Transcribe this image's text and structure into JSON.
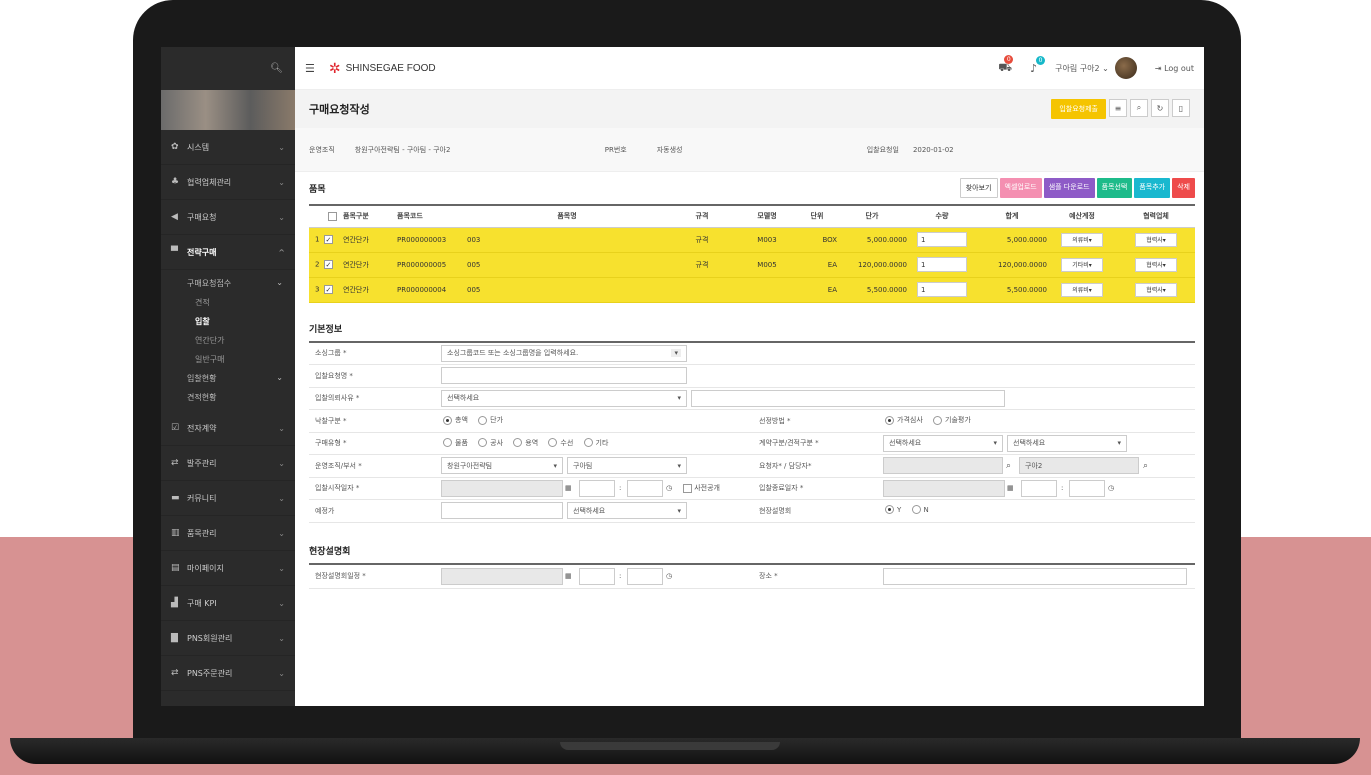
{
  "app": {
    "brand": "SHINSEGAE FOOD",
    "user": "구아림 구아2 ⌄",
    "logout": "Log out",
    "cart_badge": "0",
    "bell_badge": "0"
  },
  "sidebar": {
    "items": [
      {
        "label": "시스템",
        "icon": "gear-icon"
      },
      {
        "label": "협력업체관리",
        "icon": "users-icon"
      },
      {
        "label": "구매요청",
        "icon": "megaphone-icon"
      },
      {
        "label": "전략구매",
        "icon": "cart-icon"
      },
      {
        "label": "전자계약",
        "icon": "edit-icon"
      },
      {
        "label": "발주관리",
        "icon": "swap-icon"
      },
      {
        "label": "커뮤니티",
        "icon": "chat-icon"
      },
      {
        "label": "품목관리",
        "icon": "barcode-icon"
      },
      {
        "label": "마이페이지",
        "icon": "card-icon"
      },
      {
        "label": "구매 KPI",
        "icon": "chart-icon"
      },
      {
        "label": "PNS회원관리",
        "icon": "doc-icon"
      },
      {
        "label": "PNS주문관리",
        "icon": "swap-icon"
      }
    ],
    "sub": {
      "g1": "구매요청접수",
      "a": "견적",
      "b": "입찰",
      "c": "연간단가",
      "d": "일반구매",
      "g2": "입찰현황",
      "g3": "견적현황"
    }
  },
  "page": {
    "title": "구매요청작성",
    "submit": "입찰요청제출"
  },
  "info": {
    "org_label": "운영조직",
    "org_value": "창원구아전략팀 - 구아팀 - 구아2",
    "pr_label": "PR번호",
    "pr_value": "자동생성",
    "date_label": "입찰요청일",
    "date_value": "2020-01-02"
  },
  "items_section": {
    "title": "품목",
    "buttons": [
      "찾아보기",
      "엑셀업로드",
      "샘플 다운로드",
      "품목선택",
      "품목추가",
      "삭제"
    ],
    "headers": [
      "품목구분",
      "품목코드",
      "품목명",
      "규격",
      "모델명",
      "단위",
      "단가",
      "수량",
      "합계",
      "예산계정",
      "협력업체"
    ],
    "rows": [
      {
        "no": "1",
        "type": "연간단가",
        "code": "PR000000003",
        "name": "003",
        "spec": "규격",
        "model": "M003",
        "unit": "BOX",
        "price": "5,000.0000",
        "qty": "1",
        "total": "5,000.0000",
        "budget": "의류비▾",
        "vendor": "협력사▾"
      },
      {
        "no": "2",
        "type": "연간단가",
        "code": "PR000000005",
        "name": "005",
        "spec": "규격",
        "model": "M005",
        "unit": "EA",
        "price": "120,000.0000",
        "qty": "1",
        "total": "120,000.0000",
        "budget": "기타비▾",
        "vendor": "협력사▾"
      },
      {
        "no": "3",
        "type": "연간단가",
        "code": "PR000000004",
        "name": "005",
        "spec": "",
        "model": "",
        "unit": "EA",
        "price": "5,500.0000",
        "qty": "1",
        "total": "5,500.0000",
        "budget": "의류비▾",
        "vendor": "협력사▾"
      }
    ]
  },
  "basic": {
    "title": "기본정보",
    "sourcing_label": "소싱그룹 *",
    "sourcing_ph": "소싱그룹코드 또는 소싱그룹명을 입력하세요.",
    "bidname_label": "입찰요청명 *",
    "reason_label": "입찰의뢰사유 *",
    "reason_sel": "선택하세요",
    "award_label": "낙찰구분 *",
    "award_opts": [
      "총액",
      "단가"
    ],
    "select_label": "선정방법 *",
    "select_opts": [
      "가격심사",
      "기술평가"
    ],
    "ptype_label": "구매유형 *",
    "ptype_opts": [
      "물품",
      "공사",
      "용역",
      "수선",
      "기타"
    ],
    "contract_label": "계약구분/견적구분 *",
    "contract_sel1": "선택하세요",
    "contract_sel2": "선택하세요",
    "dept_label": "운영조직/부서 *",
    "dept_sel1": "창원구아전략팀",
    "dept_sel2": "구아팀",
    "req_label": "요청자* / 담당자*",
    "req_value": "구아2",
    "start_label": "입찰시작일자 *",
    "public_label": "사전공개",
    "end_label": "입찰종료일자 *",
    "est_label": "예정가",
    "est_sel": "선택하세요",
    "brief_label": "현장설명회",
    "brief_opts": [
      "Y",
      "N"
    ]
  },
  "site": {
    "title": "현장설명회",
    "date_label": "현장설명회일정 *",
    "place_label": "장소 *"
  }
}
